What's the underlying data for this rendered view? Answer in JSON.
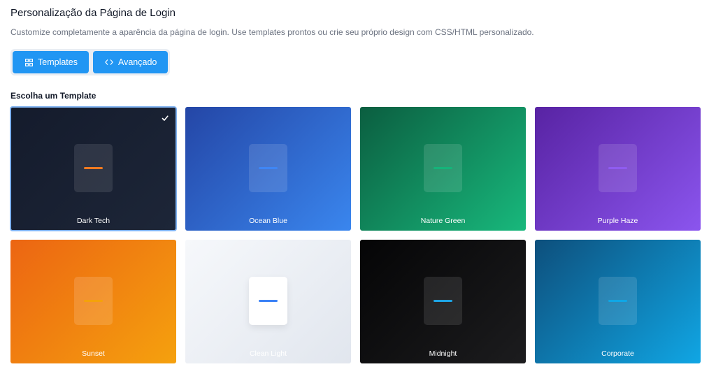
{
  "page": {
    "title": "Personalização da Página de Login",
    "description": "Customize completamente a aparência da página de login. Use templates prontos ou crie seu próprio design com CSS/HTML personalizado."
  },
  "tabs": [
    {
      "label": "Templates",
      "icon": "grid-icon"
    },
    {
      "label": "Avançado",
      "icon": "code-icon"
    }
  ],
  "section": {
    "title": "Escolha um Template"
  },
  "colors": {
    "accent": "#2196f3",
    "selected_border": "#7fb2f0"
  },
  "templates": [
    {
      "name": "Dark Tech",
      "selected": true,
      "bg_from": "#141b2c",
      "bg_to": "#1d2638",
      "mock_bg": "rgba(255,255,255,0.10)",
      "accent": "#f07a20",
      "label_color": "#ffffff"
    },
    {
      "name": "Ocean Blue",
      "selected": false,
      "bg_from": "#2446a6",
      "bg_to": "#3a86ee",
      "mock_bg": "rgba(255,255,255,0.12)",
      "accent": "#3f86f5",
      "label_color": "#ffffff"
    },
    {
      "name": "Nature Green",
      "selected": false,
      "bg_from": "#0b5e40",
      "bg_to": "#18b87c",
      "mock_bg": "rgba(255,255,255,0.12)",
      "accent": "#15b47a",
      "label_color": "#ffffff"
    },
    {
      "name": "Purple Haze",
      "selected": false,
      "bg_from": "#5823a3",
      "bg_to": "#8b55ee",
      "mock_bg": "rgba(255,255,255,0.12)",
      "accent": "#8f5cf0",
      "label_color": "#ffffff"
    },
    {
      "name": "Sunset",
      "selected": false,
      "bg_from": "#ec6512",
      "bg_to": "#f5a10e",
      "mock_bg": "rgba(255,255,255,0.14)",
      "accent": "#f5a20a",
      "label_color": "#ffffff"
    },
    {
      "name": "Clean Light",
      "selected": false,
      "bg_from": "#f6f8fb",
      "bg_to": "#e1e6ee",
      "mock_bg": "#ffffff",
      "accent": "#3b82f6",
      "label_color": "#ffffff"
    },
    {
      "name": "Midnight",
      "selected": false,
      "bg_from": "#050506",
      "bg_to": "#1c1c1e",
      "mock_bg": "rgba(255,255,255,0.10)",
      "accent": "#1ea4e4",
      "label_color": "#ffffff"
    },
    {
      "name": "Corporate",
      "selected": false,
      "bg_from": "#0d4f7c",
      "bg_to": "#10a6e4",
      "mock_bg": "rgba(255,255,255,0.12)",
      "accent": "#0fa7e6",
      "label_color": "#ffffff"
    }
  ]
}
